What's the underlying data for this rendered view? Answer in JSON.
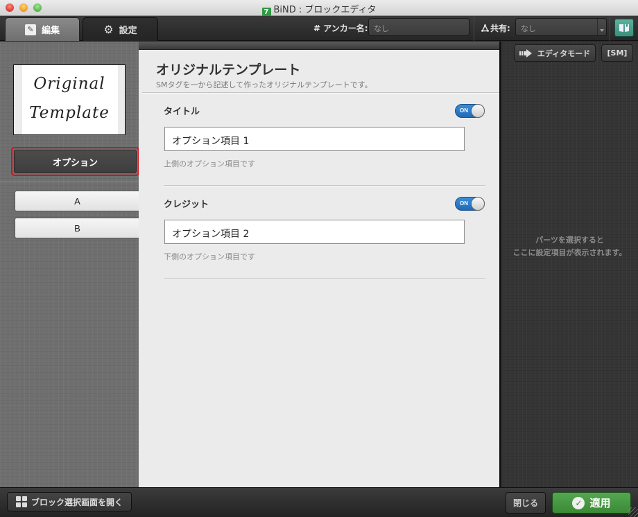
{
  "window": {
    "title": "BiND : ブロックエディタ",
    "app_badge": "7"
  },
  "toolbar": {
    "tabs": [
      {
        "label": "編集",
        "icon": "pencil-icon",
        "active": true
      },
      {
        "label": "設定",
        "icon": "gear-icon",
        "active": false
      }
    ],
    "anchor_label": "# アンカー名:",
    "anchor_placeholder": "なし",
    "share_label": "共有:",
    "share_value": "なし",
    "book_icon": "book-icon"
  },
  "left_panel": {
    "thumbnail": {
      "line1": "Original",
      "line2": "Template"
    },
    "option_button": "オプション",
    "items": [
      {
        "label": "A"
      },
      {
        "label": "B"
      }
    ]
  },
  "main": {
    "title": "オリジナルテンプレート",
    "subtitle": "SMタグを一から記述して作ったオリジナルテンプレートです。",
    "sections": [
      {
        "label": "タイトル",
        "toggle": "ON",
        "toggle_on": true,
        "value": "オプション項目 1",
        "help": "上側のオプション項目です"
      },
      {
        "label": "クレジット",
        "toggle": "ON",
        "toggle_on": true,
        "value": "オプション項目 2",
        "help": "下側のオプション項目です"
      }
    ]
  },
  "right_panel": {
    "editor_mode_label": "エディタモード",
    "sm_label": "[SM]",
    "message_line1": "パーツを選択すると",
    "message_line2": "ここに設定項目が表示されます。"
  },
  "bottom": {
    "open_block_select": "ブロック選択画面を開く",
    "close": "閉じる",
    "apply": "適用"
  },
  "colors": {
    "accent_green": "#3a8a36",
    "toggle_blue": "#1f6ab6",
    "highlight_red": "#d5101c",
    "book_teal": "#3a8f79"
  }
}
